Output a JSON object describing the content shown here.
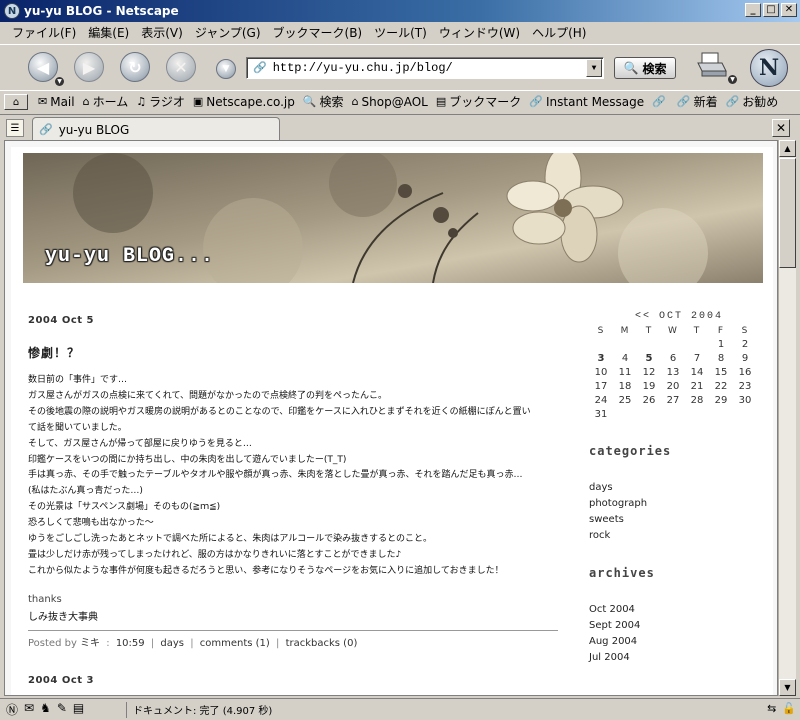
{
  "window": {
    "title": "yu-yu BLOG - Netscape"
  },
  "menu": [
    "ファイル(F)",
    "編集(E)",
    "表示(V)",
    "ジャンプ(G)",
    "ブックマーク(B)",
    "ツール(T)",
    "ウィンドウ(W)",
    "ヘルプ(H)"
  ],
  "nav": {
    "url": "http://yu-yu.chu.jp/blog/",
    "search_label": "検索"
  },
  "personal_toolbar": [
    "Mail",
    "ホーム",
    "ラジオ",
    "Netscape.co.jp",
    "検索",
    "Shop@AOL",
    "ブックマーク",
    "Instant Message",
    "新着",
    "お勧め"
  ],
  "tab": {
    "label": "yu-yu BLOG"
  },
  "blog": {
    "banner_title": "yu-yu BLOG...",
    "posts": [
      {
        "date": "2004 Oct 5",
        "title": "惨劇！？",
        "body": [
          "数日前の「事件」です…",
          "ガス屋さんがガスの点検に来てくれて、問題がなかったので点検終了の判をぺったんこ。",
          "その後地震の際の説明やガス暖房の説明があるとのことなので、印鑑をケースに入れひとまずそれを近くの紙棚にぽんと置い",
          "て話を聞いていました。",
          "そして、ガス屋さんが帰って部屋に戻りゆうを見ると…",
          "印鑑ケースをいつの間にか持ち出し、中の朱肉を出して遊んでいましたー(T_T)",
          "手は真っ赤、その手で触ったテーブルやタオルや服や顔が真っ赤、朱肉を落とした畳が真っ赤、それを踏んだ足も真っ赤…",
          "(私はたぶん真っ青だった…)",
          "その光景は「サスペンス劇場」そのもの(≧ｍ≦)",
          "恐ろしくて悲鳴も出なかった〜",
          "ゆうをごしごし洗ったあとネットで調べた所によると、朱肉はアルコールで染み抜きするとのこと。",
          "畳は少しだけ赤が残ってしまったけれど、服の方はかなりきれいに落とすことができました♪",
          "これから似たような事件が何度も起きるだろうと思い、参考になりそうなページをお気に入りに追加しておきました！"
        ],
        "thanks_label": "thanks",
        "thanks_link": "しみ抜き大事典",
        "footer": {
          "posted_by": "Posted by",
          "author": "ミキ",
          "time": "10:59",
          "category": "days",
          "comments": "comments (1)",
          "trackbacks": "trackbacks (0)"
        }
      },
      {
        "date": "2004 Oct 3"
      }
    ],
    "calendar": {
      "title": "<<  OCT 2004",
      "dow": [
        "S",
        "M",
        "T",
        "W",
        "T",
        "F",
        "S"
      ],
      "days": [
        "",
        "",
        "",
        "",
        "",
        "1",
        "2",
        "3",
        "4",
        "5",
        "6",
        "7",
        "8",
        "9",
        "10",
        "11",
        "12",
        "13",
        "14",
        "15",
        "16",
        "17",
        "18",
        "19",
        "20",
        "21",
        "22",
        "23",
        "24",
        "25",
        "26",
        "27",
        "28",
        "29",
        "30",
        "31"
      ],
      "linked_days": [
        "3",
        "5"
      ]
    },
    "categories_heading": "categories",
    "categories": [
      "days",
      "photograph",
      "sweets",
      "rock"
    ],
    "archives_heading": "archives",
    "archives": [
      "Oct 2004",
      "Sept 2004",
      "Aug 2004",
      "Jul 2004"
    ]
  },
  "status": {
    "text": "ドキュメント: 完了 (4.907 秒)"
  }
}
